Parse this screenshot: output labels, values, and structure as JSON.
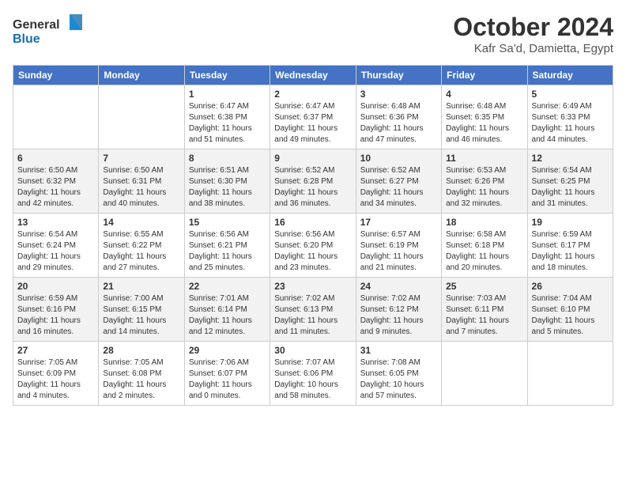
{
  "header": {
    "logo_general": "General",
    "logo_blue": "Blue",
    "month_title": "October 2024",
    "location": "Kafr Sa'd, Damietta, Egypt"
  },
  "weekdays": [
    "Sunday",
    "Monday",
    "Tuesday",
    "Wednesday",
    "Thursday",
    "Friday",
    "Saturday"
  ],
  "weeks": [
    [
      {
        "day": null,
        "info": ""
      },
      {
        "day": null,
        "info": ""
      },
      {
        "day": "1",
        "info": "Sunrise: 6:47 AM\nSunset: 6:38 PM\nDaylight: 11 hours and 51 minutes."
      },
      {
        "day": "2",
        "info": "Sunrise: 6:47 AM\nSunset: 6:37 PM\nDaylight: 11 hours and 49 minutes."
      },
      {
        "day": "3",
        "info": "Sunrise: 6:48 AM\nSunset: 6:36 PM\nDaylight: 11 hours and 47 minutes."
      },
      {
        "day": "4",
        "info": "Sunrise: 6:48 AM\nSunset: 6:35 PM\nDaylight: 11 hours and 46 minutes."
      },
      {
        "day": "5",
        "info": "Sunrise: 6:49 AM\nSunset: 6:33 PM\nDaylight: 11 hours and 44 minutes."
      }
    ],
    [
      {
        "day": "6",
        "info": "Sunrise: 6:50 AM\nSunset: 6:32 PM\nDaylight: 11 hours and 42 minutes."
      },
      {
        "day": "7",
        "info": "Sunrise: 6:50 AM\nSunset: 6:31 PM\nDaylight: 11 hours and 40 minutes."
      },
      {
        "day": "8",
        "info": "Sunrise: 6:51 AM\nSunset: 6:30 PM\nDaylight: 11 hours and 38 minutes."
      },
      {
        "day": "9",
        "info": "Sunrise: 6:52 AM\nSunset: 6:28 PM\nDaylight: 11 hours and 36 minutes."
      },
      {
        "day": "10",
        "info": "Sunrise: 6:52 AM\nSunset: 6:27 PM\nDaylight: 11 hours and 34 minutes."
      },
      {
        "day": "11",
        "info": "Sunrise: 6:53 AM\nSunset: 6:26 PM\nDaylight: 11 hours and 32 minutes."
      },
      {
        "day": "12",
        "info": "Sunrise: 6:54 AM\nSunset: 6:25 PM\nDaylight: 11 hours and 31 minutes."
      }
    ],
    [
      {
        "day": "13",
        "info": "Sunrise: 6:54 AM\nSunset: 6:24 PM\nDaylight: 11 hours and 29 minutes."
      },
      {
        "day": "14",
        "info": "Sunrise: 6:55 AM\nSunset: 6:22 PM\nDaylight: 11 hours and 27 minutes."
      },
      {
        "day": "15",
        "info": "Sunrise: 6:56 AM\nSunset: 6:21 PM\nDaylight: 11 hours and 25 minutes."
      },
      {
        "day": "16",
        "info": "Sunrise: 6:56 AM\nSunset: 6:20 PM\nDaylight: 11 hours and 23 minutes."
      },
      {
        "day": "17",
        "info": "Sunrise: 6:57 AM\nSunset: 6:19 PM\nDaylight: 11 hours and 21 minutes."
      },
      {
        "day": "18",
        "info": "Sunrise: 6:58 AM\nSunset: 6:18 PM\nDaylight: 11 hours and 20 minutes."
      },
      {
        "day": "19",
        "info": "Sunrise: 6:59 AM\nSunset: 6:17 PM\nDaylight: 11 hours and 18 minutes."
      }
    ],
    [
      {
        "day": "20",
        "info": "Sunrise: 6:59 AM\nSunset: 6:16 PM\nDaylight: 11 hours and 16 minutes."
      },
      {
        "day": "21",
        "info": "Sunrise: 7:00 AM\nSunset: 6:15 PM\nDaylight: 11 hours and 14 minutes."
      },
      {
        "day": "22",
        "info": "Sunrise: 7:01 AM\nSunset: 6:14 PM\nDaylight: 11 hours and 12 minutes."
      },
      {
        "day": "23",
        "info": "Sunrise: 7:02 AM\nSunset: 6:13 PM\nDaylight: 11 hours and 11 minutes."
      },
      {
        "day": "24",
        "info": "Sunrise: 7:02 AM\nSunset: 6:12 PM\nDaylight: 11 hours and 9 minutes."
      },
      {
        "day": "25",
        "info": "Sunrise: 7:03 AM\nSunset: 6:11 PM\nDaylight: 11 hours and 7 minutes."
      },
      {
        "day": "26",
        "info": "Sunrise: 7:04 AM\nSunset: 6:10 PM\nDaylight: 11 hours and 5 minutes."
      }
    ],
    [
      {
        "day": "27",
        "info": "Sunrise: 7:05 AM\nSunset: 6:09 PM\nDaylight: 11 hours and 4 minutes."
      },
      {
        "day": "28",
        "info": "Sunrise: 7:05 AM\nSunset: 6:08 PM\nDaylight: 11 hours and 2 minutes."
      },
      {
        "day": "29",
        "info": "Sunrise: 7:06 AM\nSunset: 6:07 PM\nDaylight: 11 hours and 0 minutes."
      },
      {
        "day": "30",
        "info": "Sunrise: 7:07 AM\nSunset: 6:06 PM\nDaylight: 10 hours and 58 minutes."
      },
      {
        "day": "31",
        "info": "Sunrise: 7:08 AM\nSunset: 6:05 PM\nDaylight: 10 hours and 57 minutes."
      },
      {
        "day": null,
        "info": ""
      },
      {
        "day": null,
        "info": ""
      }
    ]
  ]
}
